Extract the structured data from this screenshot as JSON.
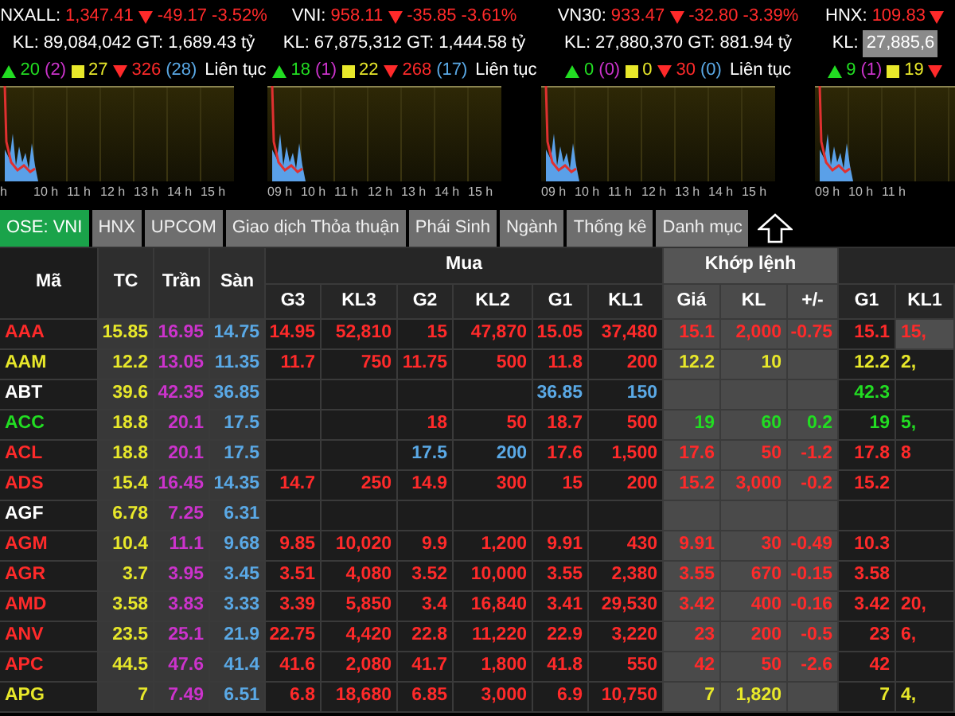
{
  "indices": [
    {
      "name": "NXALL:",
      "value": "1,347.41",
      "change": "-49.17",
      "percent": "-3.52%",
      "falling": true,
      "kl_label": "KL:",
      "kl": "89,084,042",
      "gt": "GT: 1,689.43 tỷ",
      "kl_highlighted": false,
      "up": "20",
      "ceiling": "(2)",
      "unchanged": "27",
      "down": "326",
      "floor": "(28)",
      "session": "Liên tục",
      "axis": [
        "h",
        "10 h",
        "11 h",
        "12 h",
        "13 h",
        "14 h",
        "15 h"
      ]
    },
    {
      "name": "VNI:",
      "value": "958.11",
      "change": "-35.85",
      "percent": "-3.61%",
      "falling": true,
      "kl_label": "KL:",
      "kl": "67,875,312",
      "gt": "GT: 1,444.58 tỷ",
      "kl_highlighted": false,
      "up": "18",
      "ceiling": "(1)",
      "unchanged": "22",
      "down": "268",
      "floor": "(17)",
      "session": "Liên tục",
      "axis": [
        "09 h",
        "10 h",
        "11 h",
        "12 h",
        "13 h",
        "14 h",
        "15 h"
      ]
    },
    {
      "name": "VN30:",
      "value": "933.47",
      "change": "-32.80",
      "percent": "-3.39%",
      "falling": true,
      "kl_label": "KL:",
      "kl": "27,880,370",
      "gt": "GT: 881.94 tỷ",
      "kl_highlighted": false,
      "up": "0",
      "ceiling": "(0)",
      "unchanged": "0",
      "down": "30",
      "floor": "(0)",
      "session": "Liên tục",
      "axis": [
        "09 h",
        "10 h",
        "11 h",
        "12 h",
        "13 h",
        "14 h",
        "15 h"
      ]
    },
    {
      "name": "HNX:",
      "value": "109.83",
      "falling": true,
      "kl_label": "KL:",
      "kl": "27,885,6",
      "kl_highlighted": true,
      "up": "9",
      "ceiling": "(1)",
      "unchanged": "19",
      "axis": [
        "09 h",
        "10 h",
        "11 h"
      ]
    }
  ],
  "tabs": [
    {
      "label": "OSE: VNI",
      "selected": true
    },
    {
      "label": "HNX",
      "selected": false
    },
    {
      "label": "UPCOM",
      "selected": false
    },
    {
      "label": "Giao dịch Thỏa thuận",
      "selected": false
    },
    {
      "label": "Phái Sinh",
      "selected": false
    },
    {
      "label": "Ngành",
      "selected": false
    },
    {
      "label": "Thống kê",
      "selected": false
    },
    {
      "label": "Danh mục",
      "selected": false
    }
  ],
  "header": {
    "fixed": [
      "Mã",
      "TC",
      "Trần",
      "Sàn"
    ],
    "groups": [
      {
        "label": "Mua",
        "columns": [
          "G3",
          "KL3",
          "G2",
          "KL2",
          "G1",
          "KL1"
        ]
      },
      {
        "label": "Khớp lệnh",
        "columns": [
          "Giá",
          "KL",
          "+/-"
        ]
      },
      {
        "columns": [
          "G1",
          "KL1"
        ]
      }
    ]
  },
  "rows": [
    {
      "symbol": "AAA",
      "color": "#ff2a2a",
      "ref": "15.85",
      "ceiling": "16.95",
      "floor": "14.75",
      "bid3": {
        "price": "14.95",
        "volume": "52,810",
        "kind": "down"
      },
      "bid2": {
        "price": "15",
        "volume": "47,870",
        "kind": "down"
      },
      "bid1": {
        "price": "15.05",
        "volume": "37,480",
        "kind": "down"
      },
      "match": {
        "price": "15.1",
        "volume": "2,000",
        "change": "-0.75",
        "kind": "down"
      },
      "ask": {
        "price": "15.1",
        "volume": "15,",
        "kind": "down",
        "highlighted": true
      }
    },
    {
      "symbol": "AAM",
      "color": "#e8e82a",
      "ref": "12.2",
      "ceiling": "13.05",
      "floor": "11.35",
      "bid3": {
        "price": "11.7",
        "volume": "750",
        "kind": "down"
      },
      "bid2": {
        "price": "11.75",
        "volume": "500",
        "kind": "down"
      },
      "bid1": {
        "price": "11.8",
        "volume": "200",
        "kind": "down"
      },
      "match": {
        "price": "12.2",
        "volume": "10",
        "kind": "reference"
      },
      "ask": {
        "price": "12.2",
        "volume": "2,",
        "kind": "reference",
        "highlighted": false
      }
    },
    {
      "symbol": "ABT",
      "color": "#ffffff",
      "ref": "39.6",
      "ceiling": "42.35",
      "floor": "36.85",
      "bid1": {
        "price": "36.85",
        "volume": "150",
        "kind": "floor"
      },
      "ask": {
        "price": "42.3",
        "kind": "up",
        "highlighted": false
      }
    },
    {
      "symbol": "ACC",
      "color": "#22dd22",
      "ref": "18.8",
      "ceiling": "20.1",
      "floor": "17.5",
      "bid2": {
        "price": "18",
        "volume": "50",
        "kind": "down"
      },
      "bid1": {
        "price": "18.7",
        "volume": "500",
        "kind": "down"
      },
      "match": {
        "price": "19",
        "volume": "60",
        "change": "0.2",
        "kind": "up"
      },
      "ask": {
        "price": "19",
        "volume": "5,",
        "kind": "up",
        "highlighted": false
      }
    },
    {
      "symbol": "ACL",
      "color": "#ff2a2a",
      "ref": "18.8",
      "ceiling": "20.1",
      "floor": "17.5",
      "bid2": {
        "price": "17.5",
        "volume": "200",
        "kind": "floor"
      },
      "bid1": {
        "price": "17.6",
        "volume": "1,500",
        "kind": "down"
      },
      "match": {
        "price": "17.6",
        "volume": "50",
        "change": "-1.2",
        "kind": "down"
      },
      "ask": {
        "price": "17.8",
        "volume": "8",
        "kind": "down",
        "highlighted": false
      }
    },
    {
      "symbol": "ADS",
      "color": "#ff2a2a",
      "ref": "15.4",
      "ceiling": "16.45",
      "floor": "14.35",
      "bid3": {
        "price": "14.7",
        "volume": "250",
        "kind": "down"
      },
      "bid2": {
        "price": "14.9",
        "volume": "300",
        "kind": "down"
      },
      "bid1": {
        "price": "15",
        "volume": "200",
        "kind": "down"
      },
      "match": {
        "price": "15.2",
        "volume": "3,000",
        "change": "-0.2",
        "kind": "down"
      },
      "ask": {
        "price": "15.2",
        "kind": "down",
        "highlighted": false
      }
    },
    {
      "symbol": "AGF",
      "color": "#ffffff",
      "ref": "6.78",
      "ceiling": "7.25",
      "floor": "6.31"
    },
    {
      "symbol": "AGM",
      "color": "#ff2a2a",
      "ref": "10.4",
      "ceiling": "11.1",
      "floor": "9.68",
      "bid3": {
        "price": "9.85",
        "volume": "10,020",
        "kind": "down"
      },
      "bid2": {
        "price": "9.9",
        "volume": "1,200",
        "kind": "down"
      },
      "bid1": {
        "price": "9.91",
        "volume": "430",
        "kind": "down"
      },
      "match": {
        "price": "9.91",
        "volume": "30",
        "change": "-0.49",
        "kind": "down"
      },
      "ask": {
        "price": "10.3",
        "kind": "down",
        "highlighted": false
      }
    },
    {
      "symbol": "AGR",
      "color": "#ff2a2a",
      "ref": "3.7",
      "ceiling": "3.95",
      "floor": "3.45",
      "bid3": {
        "price": "3.51",
        "volume": "4,080",
        "kind": "down"
      },
      "bid2": {
        "price": "3.52",
        "volume": "10,000",
        "kind": "down"
      },
      "bid1": {
        "price": "3.55",
        "volume": "2,380",
        "kind": "down"
      },
      "match": {
        "price": "3.55",
        "volume": "670",
        "change": "-0.15",
        "kind": "down"
      },
      "ask": {
        "price": "3.58",
        "kind": "down",
        "highlighted": false
      }
    },
    {
      "symbol": "AMD",
      "color": "#ff2a2a",
      "ref": "3.58",
      "ceiling": "3.83",
      "floor": "3.33",
      "bid3": {
        "price": "3.39",
        "volume": "5,850",
        "kind": "down"
      },
      "bid2": {
        "price": "3.4",
        "volume": "16,840",
        "kind": "down"
      },
      "bid1": {
        "price": "3.41",
        "volume": "29,530",
        "kind": "down"
      },
      "match": {
        "price": "3.42",
        "volume": "400",
        "change": "-0.16",
        "kind": "down"
      },
      "ask": {
        "price": "3.42",
        "volume": "20,",
        "kind": "down",
        "highlighted": false
      }
    },
    {
      "symbol": "ANV",
      "color": "#ff2a2a",
      "ref": "23.5",
      "ceiling": "25.1",
      "floor": "21.9",
      "bid3": {
        "price": "22.75",
        "volume": "4,420",
        "kind": "down"
      },
      "bid2": {
        "price": "22.8",
        "volume": "11,220",
        "kind": "down"
      },
      "bid1": {
        "price": "22.9",
        "volume": "3,220",
        "kind": "down"
      },
      "match": {
        "price": "23",
        "volume": "200",
        "change": "-0.5",
        "kind": "down"
      },
      "ask": {
        "price": "23",
        "volume": "6,",
        "kind": "down",
        "highlighted": false
      }
    },
    {
      "symbol": "APC",
      "color": "#ff2a2a",
      "ref": "44.5",
      "ceiling": "47.6",
      "floor": "41.4",
      "bid3": {
        "price": "41.6",
        "volume": "2,080",
        "kind": "down"
      },
      "bid2": {
        "price": "41.7",
        "volume": "1,800",
        "kind": "down"
      },
      "bid1": {
        "price": "41.8",
        "volume": "550",
        "kind": "down"
      },
      "match": {
        "price": "42",
        "volume": "50",
        "change": "-2.6",
        "kind": "down"
      },
      "ask": {
        "price": "42",
        "kind": "down",
        "highlighted": false
      }
    },
    {
      "symbol": "APG",
      "color": "#e8e82a",
      "ref": "7",
      "ceiling": "7.49",
      "floor": "6.51",
      "bid3": {
        "price": "6.8",
        "volume": "18,680",
        "kind": "down"
      },
      "bid2": {
        "price": "6.85",
        "volume": "3,000",
        "kind": "down"
      },
      "bid1": {
        "price": "6.9",
        "volume": "10,750",
        "kind": "down"
      },
      "match": {
        "price": "7",
        "volume": "1,820",
        "kind": "reference"
      },
      "ask": {
        "price": "7",
        "volume": "4,",
        "kind": "reference",
        "highlighted": false
      }
    }
  ]
}
